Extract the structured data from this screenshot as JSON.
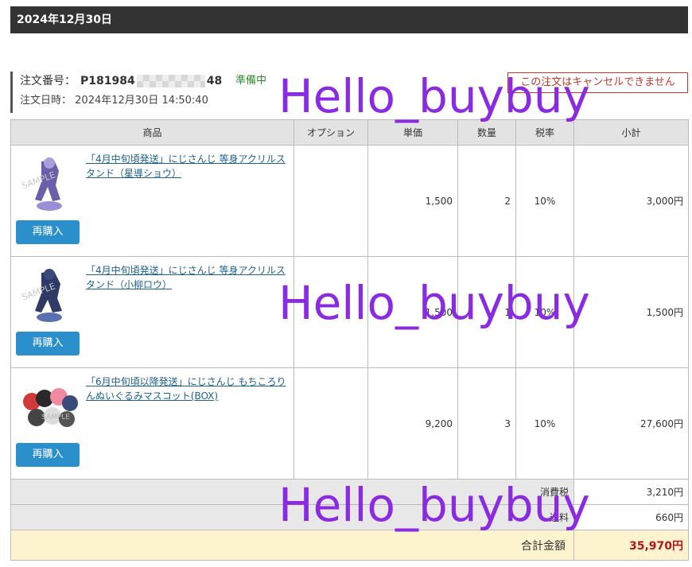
{
  "header": {
    "date": "2024年12月30日"
  },
  "order": {
    "number_label": "注文番号：",
    "number_prefix": "P181984",
    "number_suffix": "48",
    "status": "準備中",
    "datetime_label": "注文日時：",
    "datetime": "2024年12月30日 14:50:40",
    "cancel_note": "この注文はキャンセルできません"
  },
  "table": {
    "headers": [
      "商品",
      "オプション",
      "単価",
      "数量",
      "税率",
      "小計"
    ],
    "rows": [
      {
        "name": "「4月中旬頃発送」にじさんじ 等身アクリルスタンド（星導ショウ）",
        "option": "",
        "price": "1,500",
        "qty": "2",
        "tax": "10%",
        "subtotal": "3,000円",
        "rebuy": "再購入"
      },
      {
        "name": "「4月中旬頃発送」にじさんじ 等身アクリルスタンド（小柳ロウ）",
        "option": "",
        "price": "1,500",
        "qty": "1",
        "tax": "10%",
        "subtotal": "1,500円",
        "rebuy": "再購入"
      },
      {
        "name": "「6月中旬頃以降発送」にじさんじ もちころりんぬいぐるみマスコット(BOX)",
        "option": "",
        "price": "9,200",
        "qty": "3",
        "tax": "10%",
        "subtotal": "27,600円",
        "rebuy": "再購入"
      }
    ],
    "summary": {
      "tax_label": "消費税",
      "tax_value": "3,210円",
      "shipping_label": "送料",
      "shipping_value": "660円",
      "total_label": "合計金額",
      "total_value": "35,970円"
    }
  },
  "watermark": "Hello_buybuy",
  "colors": {
    "accent_button": "#2b8fcc",
    "status_green": "#2e8b2e",
    "cancel_red": "#c0392b",
    "total_red": "#b01818",
    "total_bg": "#fdf3cf",
    "watermark": "#8a2be2"
  }
}
